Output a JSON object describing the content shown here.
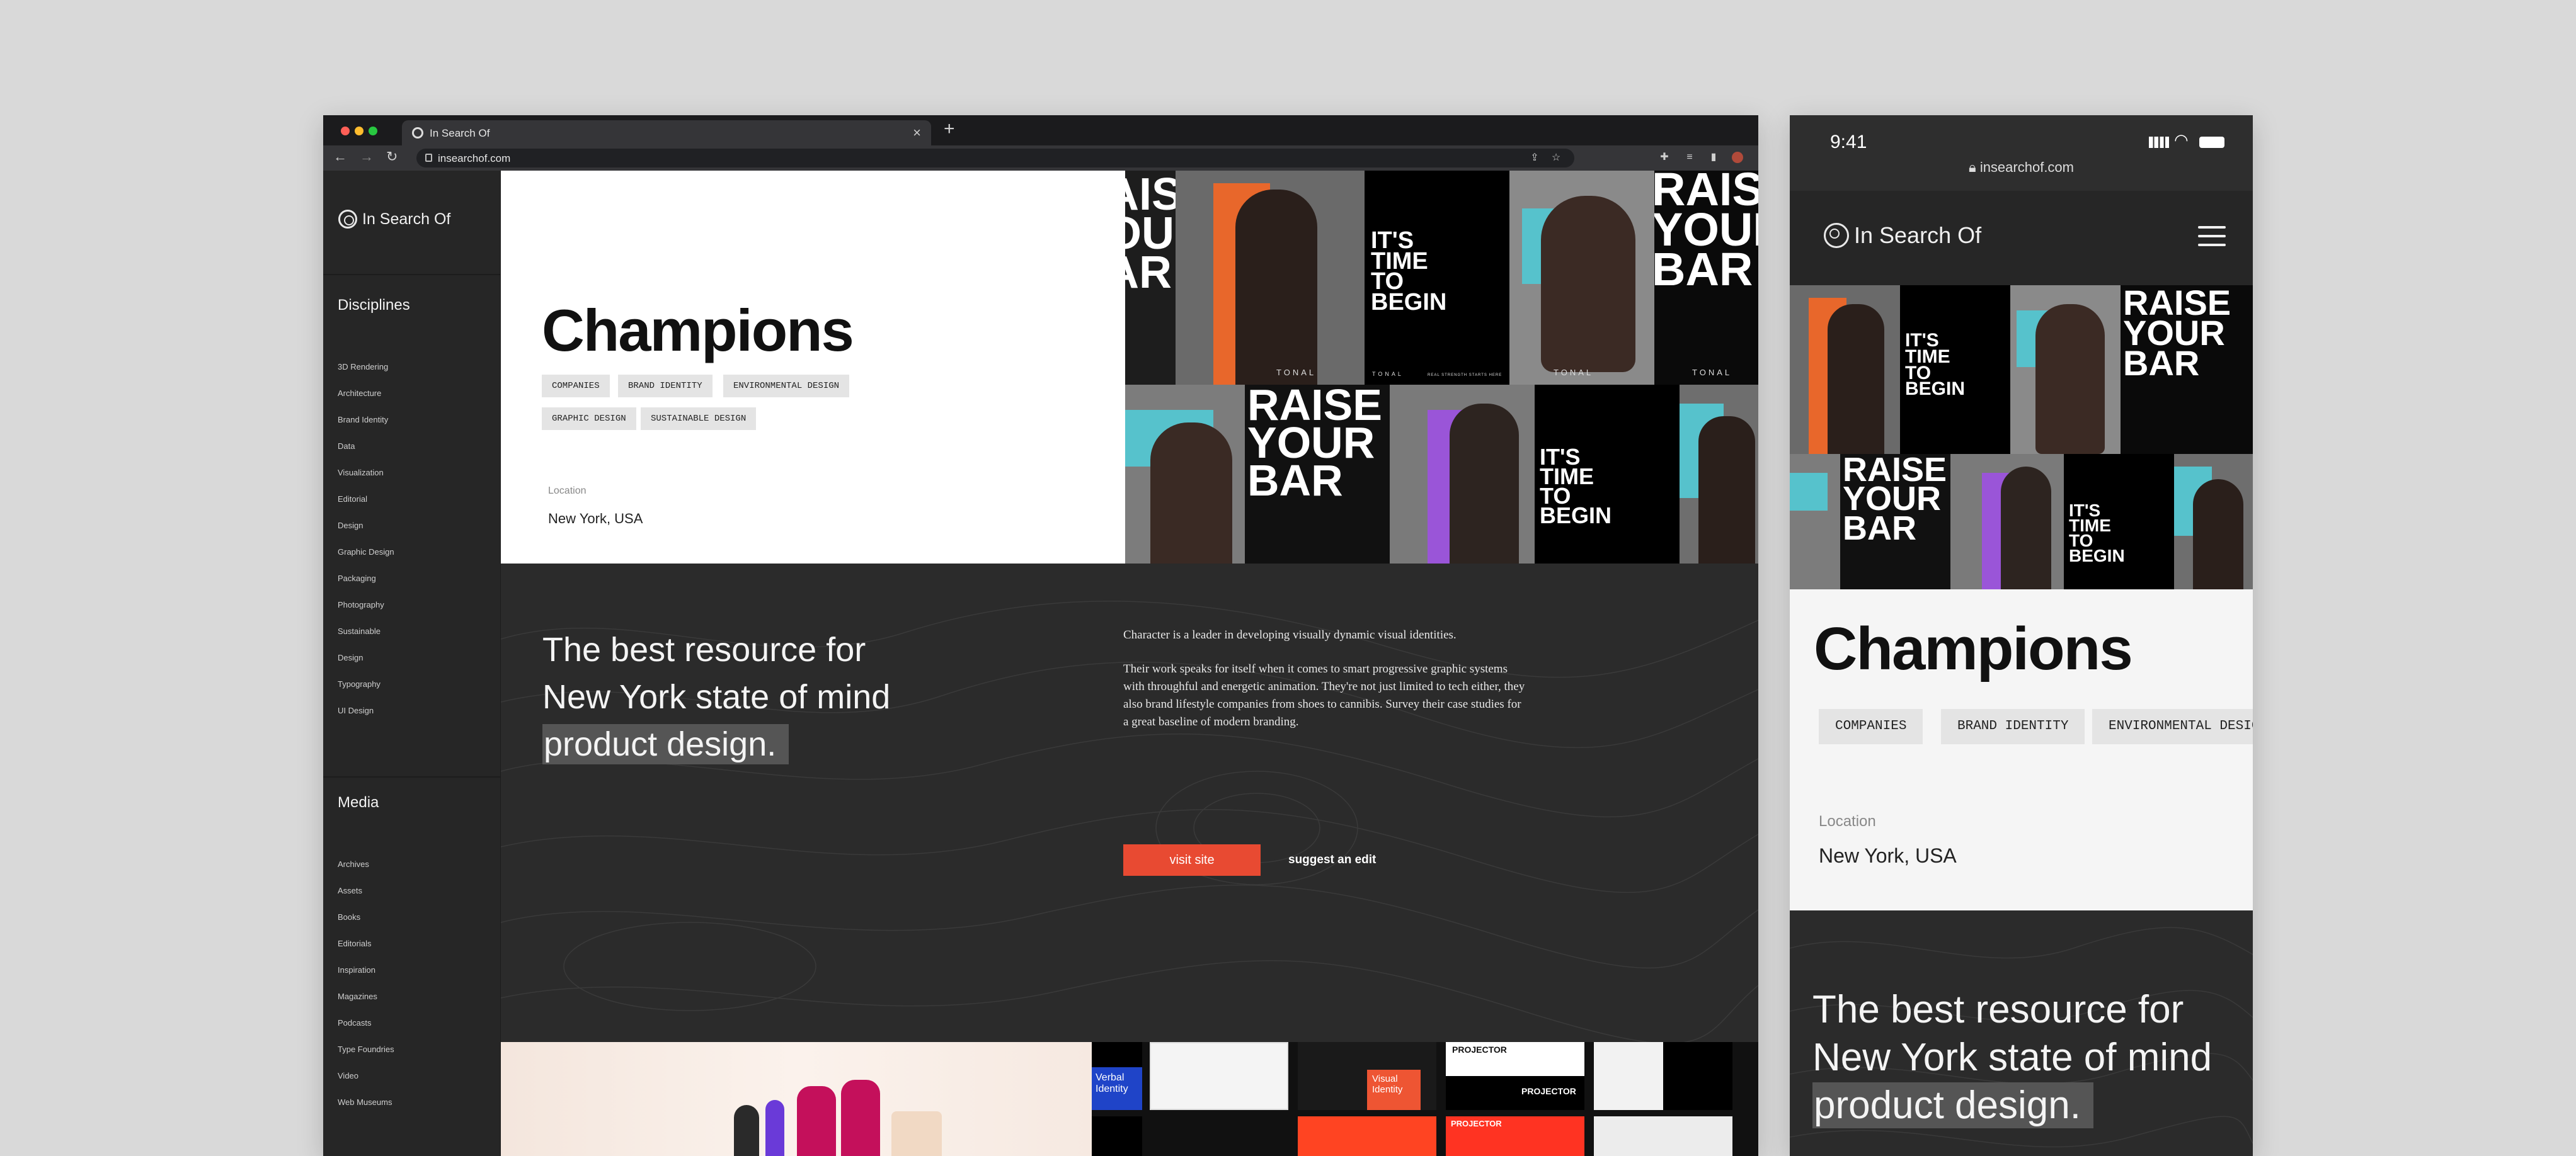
{
  "browser": {
    "tab_title": "In Search Of",
    "url": "insearchof.com"
  },
  "site": {
    "logo_text": "In Search Of",
    "disciplines_heading": "Disciplines",
    "disciplines": [
      "3D Rendering",
      "Architecture",
      "Brand Identity",
      "Data",
      "Visualization",
      "Editorial",
      "Design",
      "Graphic Design",
      "Packaging",
      "Photography",
      "Sustainable",
      "Design",
      "Typography",
      "UI Design"
    ],
    "media_heading": "Media",
    "media": [
      "Archives",
      "Assets",
      "Books",
      "Editorials",
      "Inspiration",
      "Magazines",
      "Podcasts",
      "Type Foundries",
      "Video",
      "Web Museums"
    ]
  },
  "detail": {
    "title": "Champions",
    "tags": [
      "COMPANIES",
      "BRAND IDENTITY",
      "ENVIRONMENTAL DESIGN",
      "GRAPHIC DESIGN",
      "SUSTAINABLE DESIGN"
    ],
    "location_label": "Location",
    "location_value": "New York, USA",
    "tagline_line1": "The best resource for",
    "tagline_line2": "New York state of mind",
    "tagline_line3": "product design.",
    "desc_p1": "Character is a leader in developing visually dynamic visual identities.",
    "desc_p2": "Their work speaks for itself when it comes to smart progressive graphic systems with throughful and energetic animation. They're not just limited to tech either, they also brand lifestyle companies from shoes to cannibis. Survey their case studies for a great baseline of modern branding.",
    "visit_label": "visit site",
    "suggest_label": "suggest an edit"
  },
  "collage": {
    "raise_text": "RAISE YOUR BAR",
    "raise_partial": "AISE OUR AR",
    "time_text": "IT'S TIME TO BEGIN",
    "brand": "TONAL",
    "fineprint": "REAL STRENGTH STARTS HERE"
  },
  "thumbs": {
    "verbal": "Verbal Identity",
    "visual": "Visual Identity",
    "projector": "PROJECTOR"
  },
  "mobile": {
    "time": "9:41",
    "url": "insearchof.com"
  },
  "colors": {
    "accent": "#e84a32",
    "dark_bg": "#2b2b2b",
    "sidebar_bg": "#262626"
  }
}
